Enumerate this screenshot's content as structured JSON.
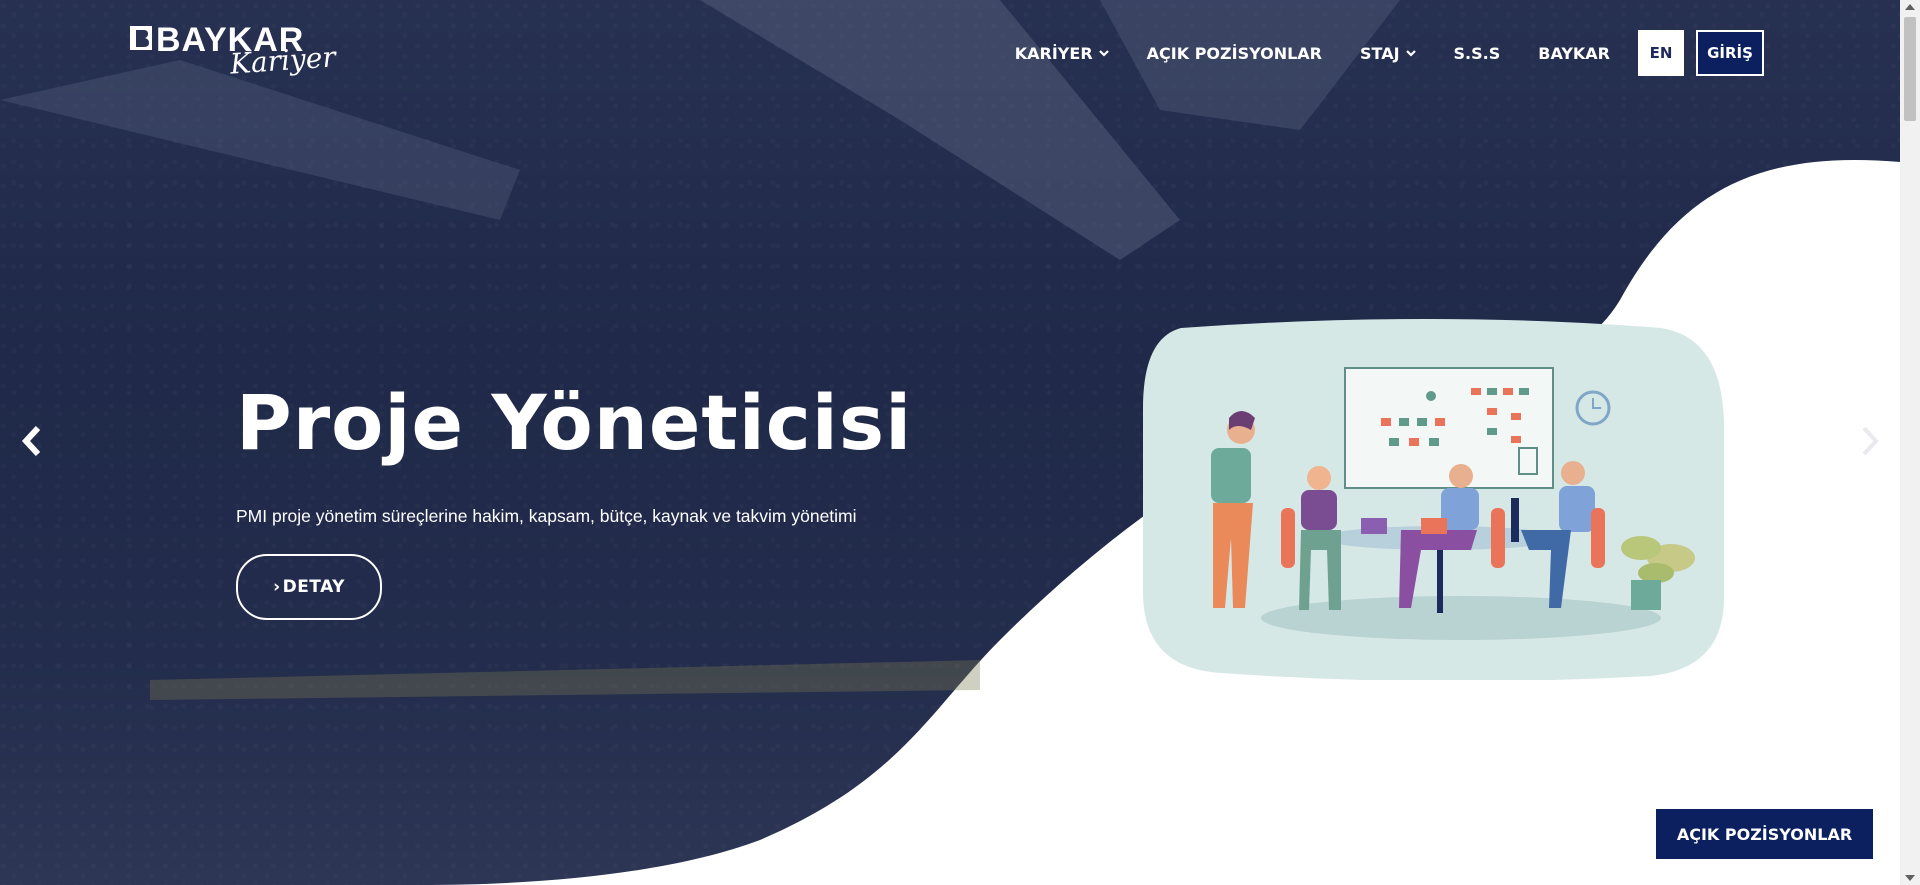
{
  "brand": {
    "name": "BAYKAR",
    "script": "Kariyer"
  },
  "nav": {
    "items": [
      {
        "label": "KARİYER",
        "has_dropdown": true
      },
      {
        "label": "AÇIK POZİSYONLAR",
        "has_dropdown": false
      },
      {
        "label": "STAJ",
        "has_dropdown": true
      },
      {
        "label": "S.S.S",
        "has_dropdown": false
      },
      {
        "label": "BAYKAR",
        "has_dropdown": false
      }
    ],
    "lang_label": "EN",
    "login_label": "GİRİŞ"
  },
  "slide": {
    "title": "Proje Yöneticisi",
    "description": "PMI proje yönetim süreçlerine hakim, kapsam, bütçe, kaynak ve takvim yönetimi",
    "detail_label": "DETAY",
    "detail_prefix": "›"
  },
  "floating_button": {
    "label": "AÇIK POZİSYONLAR"
  },
  "colors": {
    "navy": "#0c2060",
    "overlay": "#1b2447",
    "illustration_bg": "#d6e8e6",
    "white": "#ffffff"
  },
  "icons": {
    "prev": "chevron-left-icon",
    "next": "chevron-right-icon",
    "dropdown": "chevron-down-icon"
  }
}
